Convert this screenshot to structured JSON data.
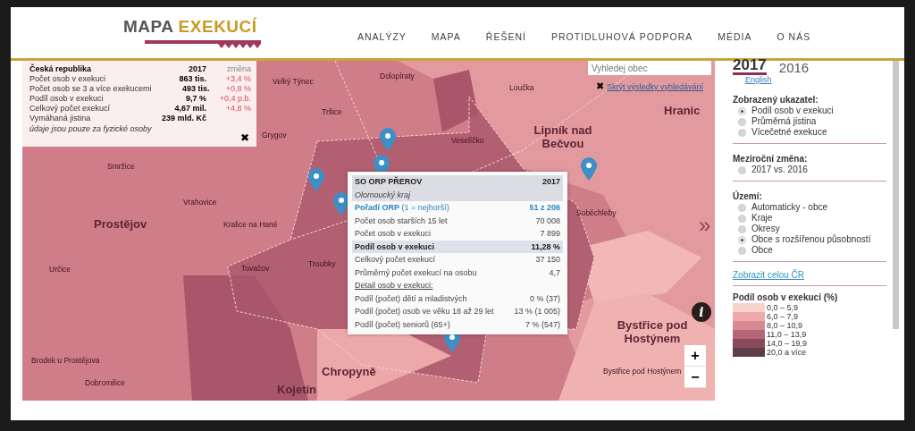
{
  "logo": {
    "part_1": "MAPA",
    "part_2": "EXEKUCÍ"
  },
  "nav": [
    "ANALÝZY",
    "MAPA",
    "ŘEŠENÍ",
    "PROTIDLUHOVÁ PODPORA",
    "MÉDIA",
    "O NÁS"
  ],
  "summary": {
    "title": "Česká republika",
    "year": "2017",
    "change_label": "změna",
    "rows": [
      {
        "label": "Počet osob v exekuci",
        "value": "863 tis.",
        "change": "+3,4 %"
      },
      {
        "label": "Počet osob se 3 a více exekucemi",
        "value": "493 tis.",
        "change": "+0,8 %"
      },
      {
        "label": "Podíl osob v exekuci",
        "value": "9,7 %",
        "change": "+0,4 p.b."
      },
      {
        "label": "Celkový počet exekucí",
        "value": "4,67 mil.",
        "change": "+4,8 %"
      },
      {
        "label": "Vymáhaná jistina",
        "value": "239 mld. Kč",
        "change": ""
      }
    ],
    "note": "údaje jsou pouze za fyzické osoby",
    "close": "✖"
  },
  "search": {
    "placeholder": "Vyhledej obec",
    "hide_close": "✖",
    "hide_link": "Skrýt výsledky vyhledávání"
  },
  "places": [
    {
      "name": "Dolopíraty",
      "kind": "village"
    },
    {
      "name": "Velký Týnec",
      "kind": "village"
    },
    {
      "name": "Loučka",
      "kind": "village"
    },
    {
      "name": "Hranic",
      "kind": "town"
    },
    {
      "name": "Tršice",
      "kind": "village"
    },
    {
      "name": "Grygov",
      "kind": "village"
    },
    {
      "name": "Veselíčko",
      "kind": "village"
    },
    {
      "name": "Lipník nad Bečvou",
      "kind": "town"
    },
    {
      "name": "Smržice",
      "kind": "village"
    },
    {
      "name": "Vrahovice",
      "kind": "village"
    },
    {
      "name": "Soběchleby",
      "kind": "village"
    },
    {
      "name": "Prostějov",
      "kind": "town"
    },
    {
      "name": "Kralice na Hané",
      "kind": "village"
    },
    {
      "name": "Určice",
      "kind": "village"
    },
    {
      "name": "Tovačov",
      "kind": "village"
    },
    {
      "name": "Troubky",
      "kind": "village"
    },
    {
      "name": "Bystřice pod Hostýnem",
      "kind": "town"
    },
    {
      "name": "Bystřice pod Hostýnem",
      "kind": "village"
    },
    {
      "name": "Brodek u Prostějova",
      "kind": "village"
    },
    {
      "name": "Dobromilice",
      "kind": "village"
    },
    {
      "name": "Chropyně",
      "kind": "town"
    },
    {
      "name": "Kojetín",
      "kind": "town"
    }
  ],
  "popup": {
    "title": "SO ORP PŘEROV",
    "year": "2017",
    "region": "Olomoucký kraj",
    "rank": {
      "label": "Pořadí ORP",
      "hint": "(1 = nejhorší)",
      "value": "51 z 206"
    },
    "rows": [
      {
        "label": "Počet osob starších 15 let",
        "value": "70 008",
        "kind": "plain"
      },
      {
        "label": "Počet osob v exekuci",
        "value": "7 899",
        "kind": "plain"
      },
      {
        "label": "Podíl osob v exekuci",
        "value": "11,28 %",
        "kind": "highlight"
      },
      {
        "label": "Celkový počet exekucí",
        "value": "37 150",
        "kind": "plain"
      },
      {
        "label": "Průměrný počet exekucí na osobu",
        "value": "4,7",
        "kind": "plain"
      },
      {
        "label": "Detail osob v exekuci:",
        "value": "",
        "kind": "heading"
      },
      {
        "label": "Podíl (počet) dětí a mladistvých",
        "value": "0 % (37)",
        "kind": "plain"
      },
      {
        "label": "Podíl (počet) osob ve věku 18 až 29 let",
        "value": "13 % (1 005)",
        "kind": "plain"
      },
      {
        "label": "Podíl (počet) seniorů (65+)",
        "value": "7 % (547)",
        "kind": "plain"
      }
    ]
  },
  "info": "i",
  "zoom": [
    "+",
    "−"
  ],
  "collapse": "»",
  "years": [
    {
      "label": "2017",
      "selected": true
    },
    {
      "label": "2016",
      "selected": false
    }
  ],
  "language_link": "English",
  "sections": [
    {
      "title": "Zobrazený ukazatel:",
      "options": [
        {
          "label": "Podíl osob v exekuci",
          "selected": true
        },
        {
          "label": "Průměrná jistina",
          "selected": false
        },
        {
          "label": "Vícečetné exekuce",
          "selected": false
        }
      ]
    },
    {
      "title": "Meziroční změna:",
      "options": [
        {
          "label": "2017 vs. 2016",
          "selected": false
        }
      ]
    },
    {
      "title": "Území:",
      "options": [
        {
          "label": "Automaticky - obce",
          "selected": false
        },
        {
          "label": "Kraje",
          "selected": false
        },
        {
          "label": "Okresy",
          "selected": false
        },
        {
          "label": "Obce s rozšířenou působností",
          "selected": true
        },
        {
          "label": "Obce",
          "selected": false
        }
      ]
    }
  ],
  "show_all_link": "Zobrazit celou ČR",
  "legend": {
    "title": "Podíl osob v exekuci (%)",
    "items": [
      {
        "label": "0,0 – 5,9",
        "color": "#f8d3cb"
      },
      {
        "label": "6,0 – 7,9",
        "color": "#eeaaa9"
      },
      {
        "label": "8,0 – 10,9",
        "color": "#d88a93"
      },
      {
        "label": "11,0 – 13,9",
        "color": "#b56678"
      },
      {
        "label": "14,0 – 19,9",
        "color": "#884a5d"
      },
      {
        "label": "20,0 a více",
        "color": "#5d3e49"
      }
    ]
  }
}
